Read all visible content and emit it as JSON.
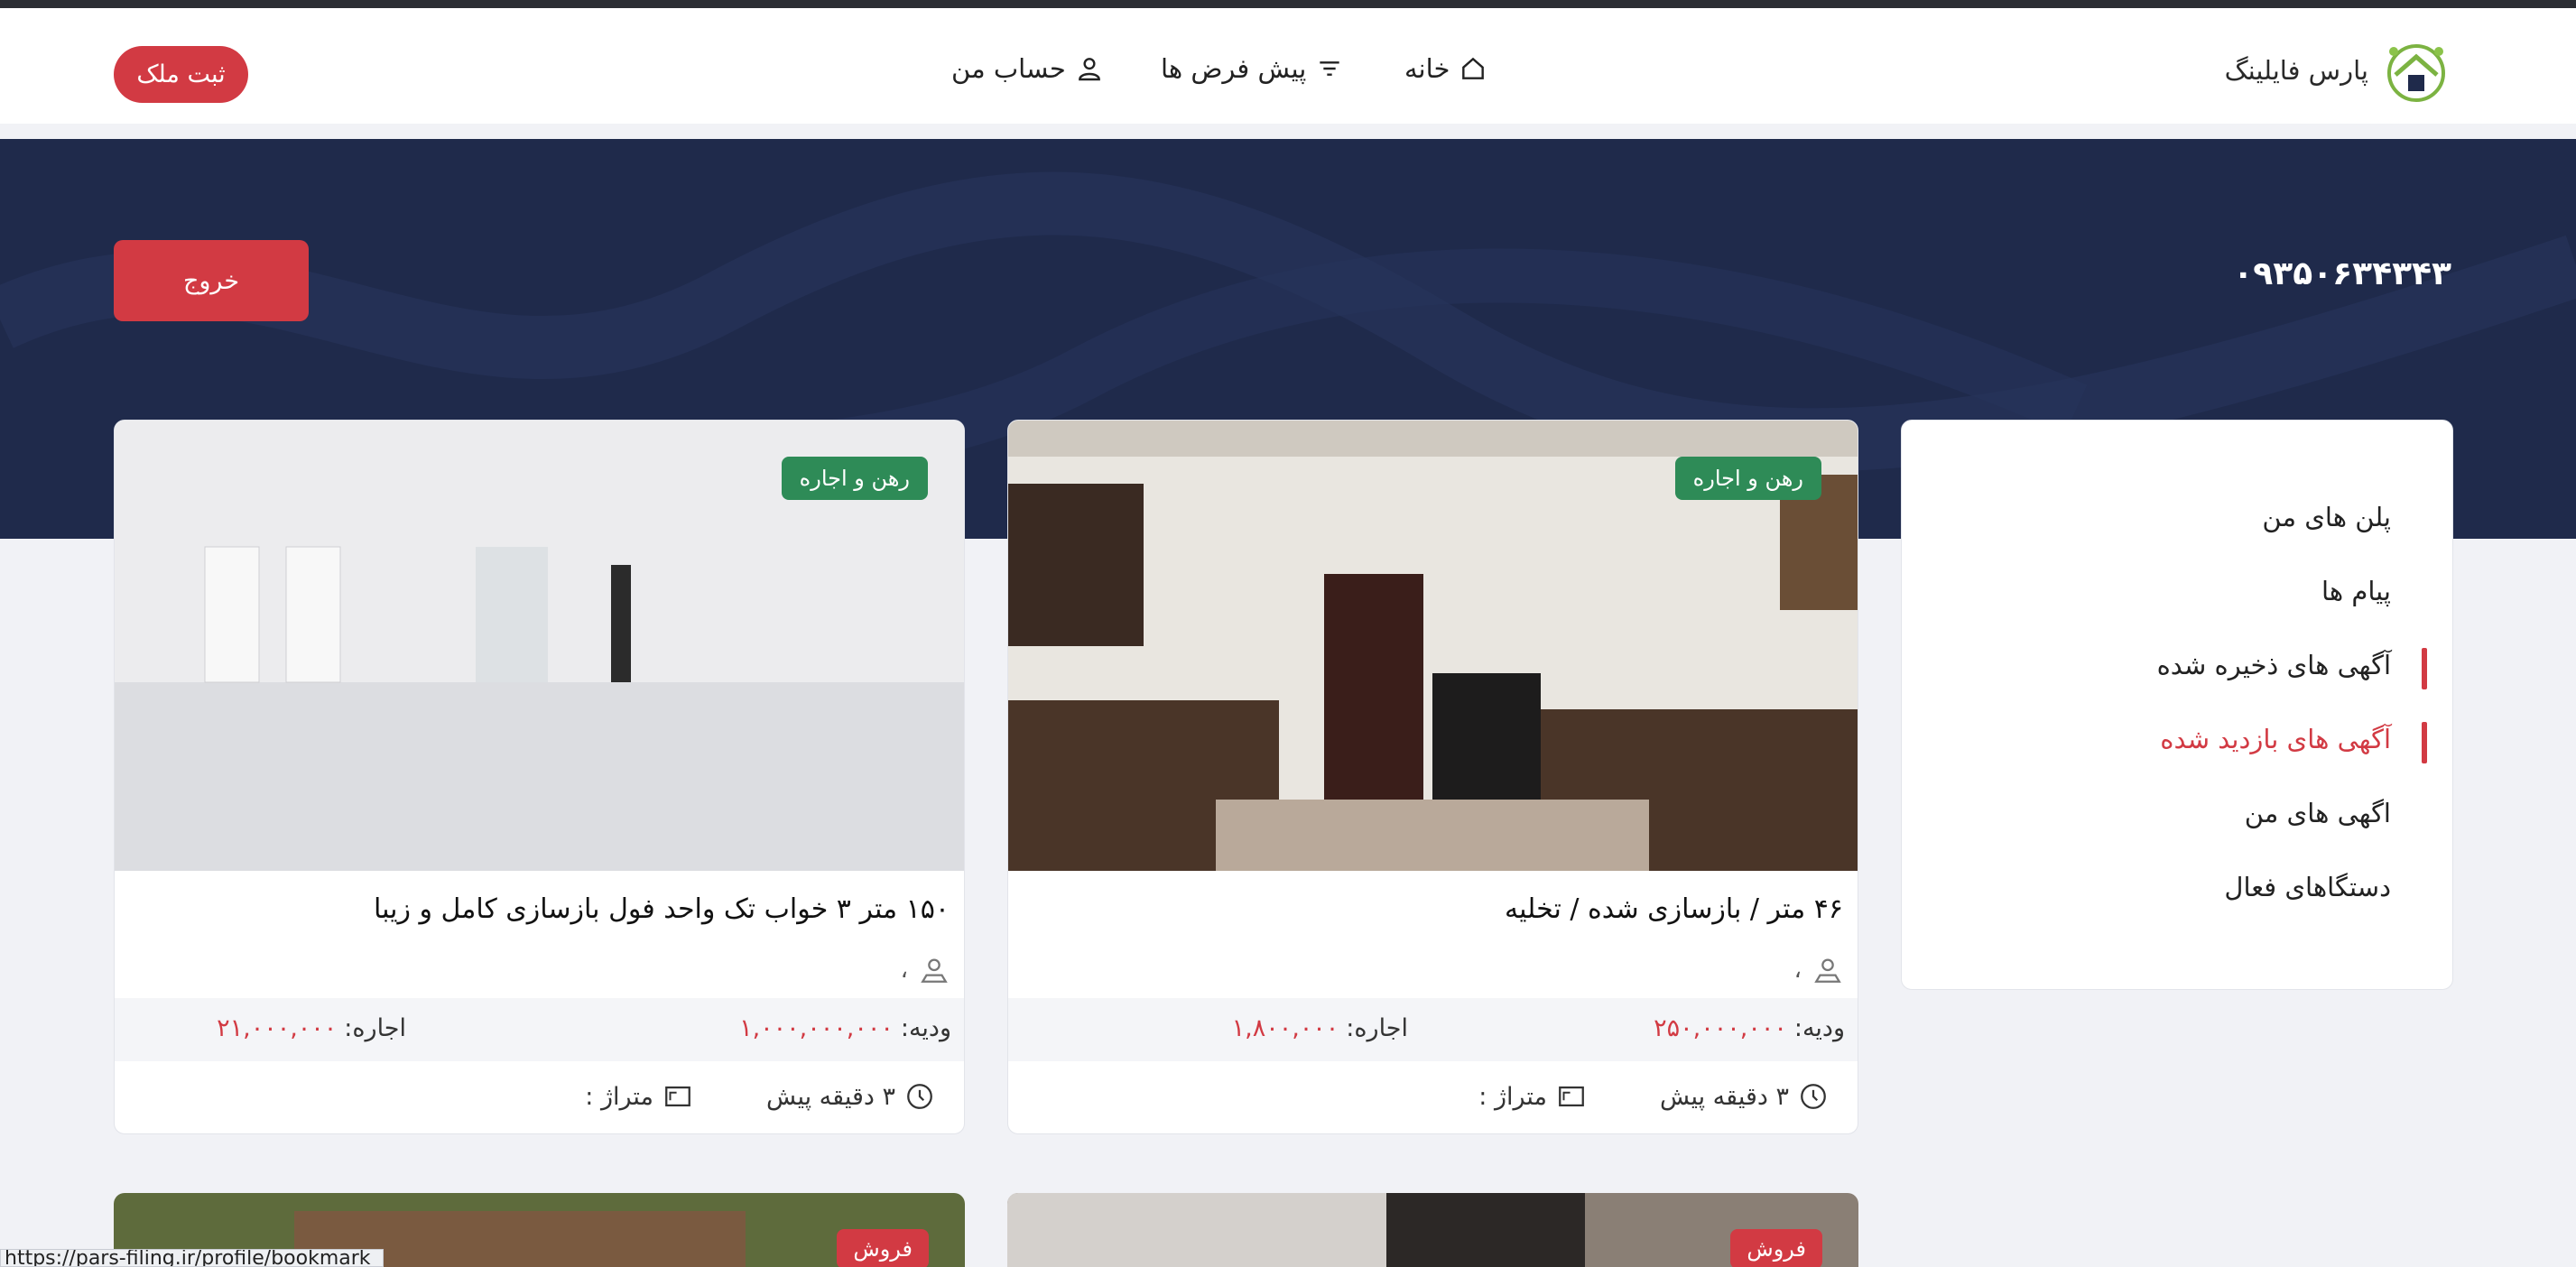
{
  "header": {
    "logo_text": "پارس فایلینگ",
    "nav": [
      {
        "label": "خانه",
        "icon": "home-icon"
      },
      {
        "label": "پیش فرض ها",
        "icon": "filter-icon"
      },
      {
        "label": "حساب من",
        "icon": "user-icon"
      }
    ],
    "register_button": "ثبت ملک"
  },
  "profile": {
    "phone": "۰۹۳۵۰۶۳۴۳۴۳",
    "logout_button": "خروج"
  },
  "sidebar": {
    "items": [
      {
        "label": "پلن های من",
        "active": false,
        "marked": false
      },
      {
        "label": "پیام ها",
        "active": false,
        "marked": false
      },
      {
        "label": "آگهی های ذخیره شده",
        "active": false,
        "marked": true
      },
      {
        "label": "آگهی های بازدید شده",
        "active": true,
        "marked": true
      },
      {
        "label": "اگهی های من",
        "active": false,
        "marked": false
      },
      {
        "label": "دستگاهای فعال",
        "active": false,
        "marked": false
      }
    ]
  },
  "listings": [
    {
      "badge": "رهن و اجاره",
      "title": "۴۶ متر / بازسازی شده / تخلیه",
      "location": "،",
      "deposit_label": "ودیه:",
      "deposit_value": "۲۵۰,۰۰۰,۰۰۰",
      "rent_label": "اجاره:",
      "rent_value": "۱,۸۰۰,۰۰۰",
      "time": "۳ دقیقه پیش",
      "area_label": "متراژ :"
    },
    {
      "badge": "رهن و اجاره",
      "title": "۱۵۰ متر ۳ خواب تک واحد فول بازسازی کامل و زیبا",
      "location": "،",
      "deposit_label": "ودیه:",
      "deposit_value": "۱,۰۰۰,۰۰۰,۰۰۰",
      "rent_label": "اجاره:",
      "rent_value": "۲۱,۰۰۰,۰۰۰",
      "time": "۳ دقیقه پیش",
      "area_label": "متراژ :"
    }
  ],
  "listings_row2": [
    {
      "badge": "فروش"
    },
    {
      "badge": "فروش"
    }
  ],
  "status_bar": "https://pars-filing.ir/profile/bookmark",
  "colors": {
    "accent": "#d23a43",
    "hero": "#1f2a4b",
    "badge_rent": "#2e8b57"
  }
}
